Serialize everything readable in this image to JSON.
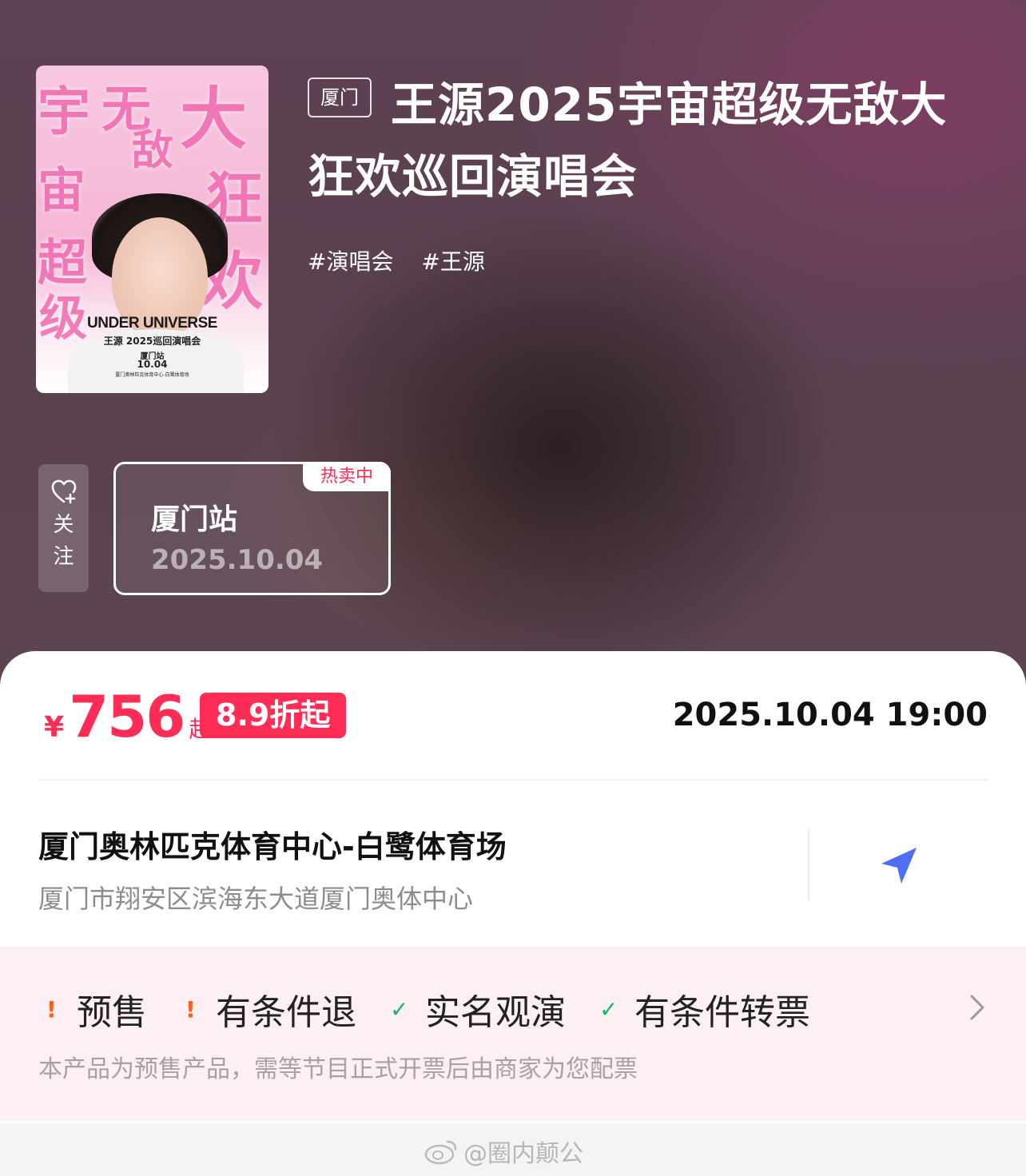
{
  "hero": {
    "city_tag": "厦门",
    "title": "王源2025宇宙超级无敌大狂欢巡回演唱会",
    "tags": [
      "#演唱会",
      "#王源"
    ],
    "poster": {
      "chars_left": [
        "宇",
        "宙",
        "超",
        "级"
      ],
      "chars_mid": [
        "无",
        "敌"
      ],
      "chars_right": [
        "大",
        "狂",
        "欢"
      ],
      "brand": "UNDER UNIVERSE",
      "line1": "王源  2025巡回演唱会",
      "line2": "厦门站",
      "line3": "10.04",
      "line4": "厦门奥林匹克体育中心-白鹭体育场"
    },
    "follow_label_1": "关",
    "follow_label_2": "注",
    "session": {
      "badge": "热卖中",
      "name": "厦门站",
      "date": "2025.10.04"
    }
  },
  "card": {
    "currency": "¥",
    "price": "756",
    "price_suffix": "起",
    "discount": "8.9折起",
    "show_time": "2025.10.04 19:00",
    "venue_name": "厦门奥林匹克体育中心-白鹭体育场",
    "venue_address": "厦门市翔安区滨海东大道厦门奥体中心",
    "policies": [
      {
        "mark": "!",
        "type": "warn",
        "label": "预售"
      },
      {
        "mark": "!",
        "type": "warn",
        "label": "有条件退"
      },
      {
        "mark": "✓",
        "type": "ok",
        "label": "实名观演"
      },
      {
        "mark": "✓",
        "type": "ok",
        "label": "有条件转票"
      }
    ],
    "policy_note": "本产品为预售产品，需等节目正式开票后由商家为您配票"
  },
  "watermark": "@圈内颠公",
  "icons": {
    "follow": "heart-plus-icon",
    "navigate": "navigation-arrow-icon",
    "chevron": "chevron-right-icon"
  },
  "colors": {
    "accent": "#ff2d55",
    "nav": "#4f6ef7",
    "ok": "#10b86c",
    "warn": "#ff5a1f"
  }
}
